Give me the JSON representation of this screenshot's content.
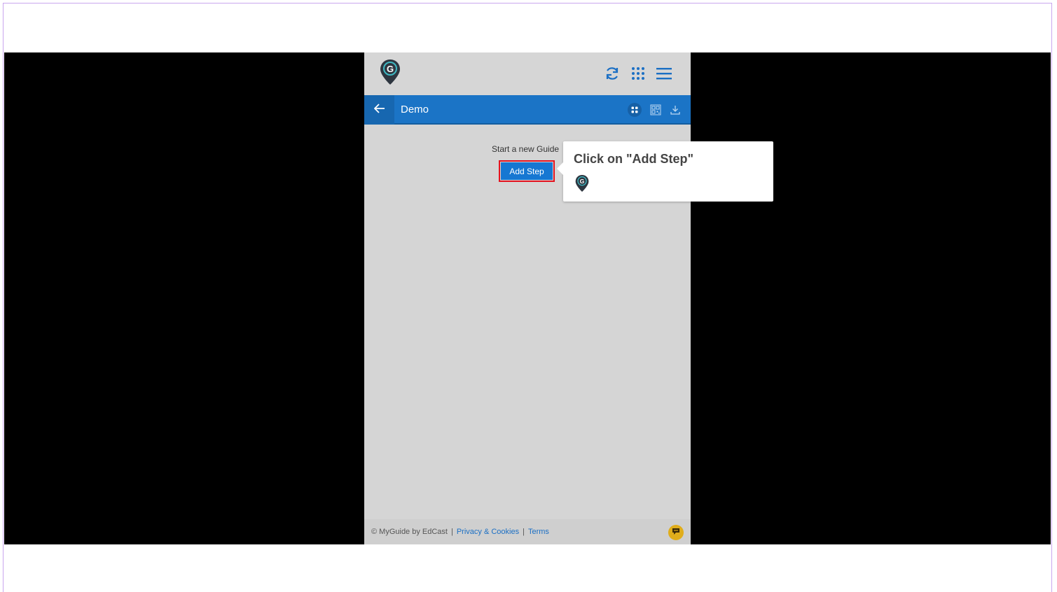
{
  "panel": {
    "title": "Demo",
    "start_text": "Start a new Guide",
    "add_step_label": "Add Step"
  },
  "icons": {
    "logo": "myguide-logo-icon",
    "refresh": "refresh-icon",
    "apps": "apps-grid-icon",
    "menu": "hamburger-menu-icon",
    "back": "arrow-left-icon",
    "grid_view": "grid-view-icon",
    "qr": "qr-code-icon",
    "download": "download-icon",
    "chat": "chat-icon"
  },
  "footer": {
    "copyright": "© MyGuide by EdCast",
    "privacy": "Privacy & Cookies",
    "terms": "Terms"
  },
  "tooltip": {
    "text": "Click on \"Add Step\""
  },
  "colors": {
    "accent_blue": "#1b74c6",
    "button_blue": "#1677d2",
    "highlight_red": "#e3131f",
    "chat_yellow": "#e0ad1b",
    "logo_dark": "#2e3640",
    "logo_teal": "#3fb8c2"
  }
}
